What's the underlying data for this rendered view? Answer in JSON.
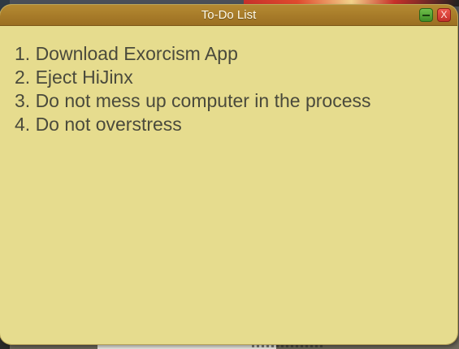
{
  "window": {
    "title": "To-Do List",
    "close_label": "X"
  },
  "todo": {
    "items": [
      "1. Download Exorcism App",
      "2. Eject HiJinx",
      "3. Do not mess up computer in the process",
      "4. Do not overstress"
    ]
  },
  "colors": {
    "titlebar": "#9b6f22",
    "window_body": "#e6dc8e",
    "text": "#4a4a3c",
    "minimize_button": "#3f8e27",
    "close_button": "#c4302a"
  },
  "icons": {
    "minimize": "minimize-icon",
    "close": "close-icon"
  }
}
